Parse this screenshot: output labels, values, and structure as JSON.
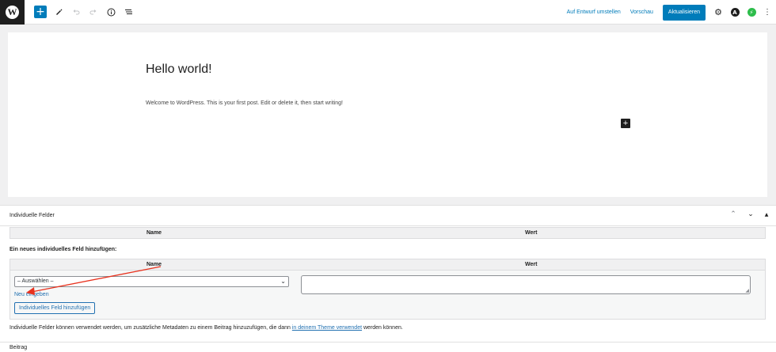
{
  "toolbar": {
    "logo_letter": "W",
    "add_block_icon": "plus-icon",
    "tools_icon": "pencil-icon",
    "undo_icon": "undo-icon",
    "redo_icon": "redo-icon",
    "details_icon": "info-icon",
    "outline_icon": "list-view-icon",
    "switch_to_draft_label": "Auf Entwurf umstellen",
    "preview_label": "Vorschau",
    "update_label": "Aktualisieren",
    "settings_icon": "gear-icon",
    "plugin1_letter": "A",
    "plugin2_letter": "⚡",
    "more_icon": "more-vertical-icon",
    "accent_color": "#007cba"
  },
  "post": {
    "title": "Hello world!",
    "content": "Welcome to WordPress. This is your first post. Edit or delete it, then start writing!"
  },
  "metabox": {
    "title": "Individuelle Felder",
    "controls": [
      "chevron-up-icon",
      "chevron-down-icon",
      "triangle-up-icon"
    ],
    "table_headers": {
      "name": "Name",
      "value": "Wert"
    },
    "add_new_heading": "Ein neues individuelles Feld hinzufügen:",
    "select_value": "– Auswählen –",
    "new_link": "Neu eingeben",
    "add_button": "Individuelles Feld hinzufügen",
    "description_before": "Individuelle Felder können verwendet werden, um zusätzliche Metadaten zu einem Beitrag hinzuzufügen, die dann ",
    "description_link": "in deinem Theme verwendet",
    "description_after": " werden können."
  },
  "footer": {
    "breadcrumb": "Beitrag"
  },
  "annotation": {
    "arrow_color": "#e8321e"
  }
}
